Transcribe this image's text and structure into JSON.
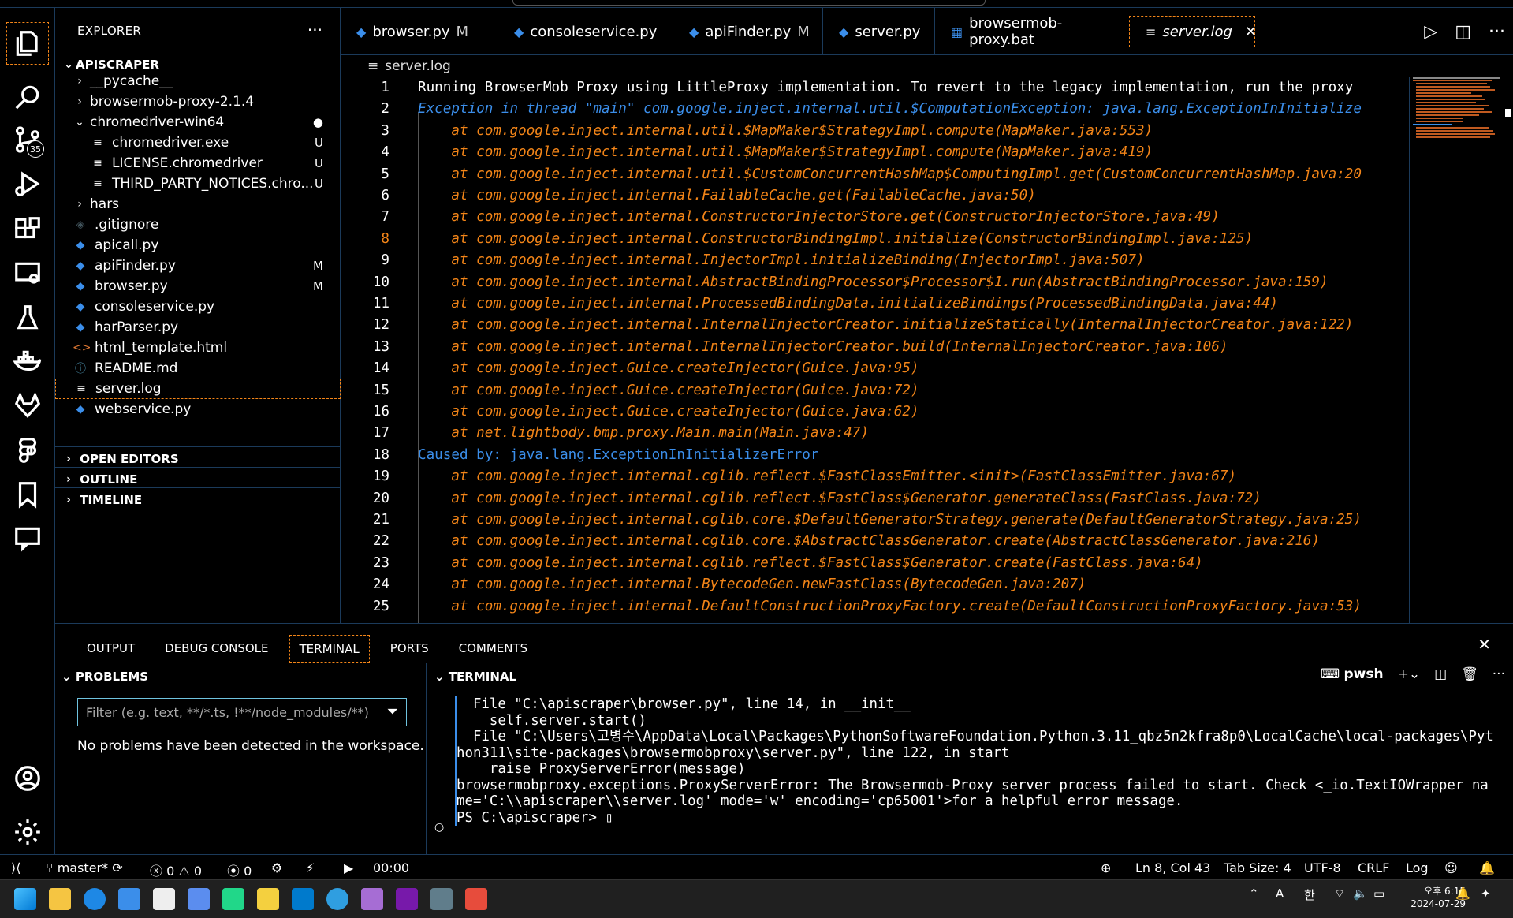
{
  "sidebar": {
    "title": "EXPLORER",
    "more": "···",
    "root": "APISCRAPER",
    "items": [
      {
        "label": "__pycache__",
        "type": "folder",
        "expanded": false,
        "mark": ""
      },
      {
        "label": "browsermob-proxy-2.1.4",
        "type": "folder",
        "expanded": false,
        "mark": ""
      },
      {
        "label": "chromedriver-win64",
        "type": "folder",
        "expanded": true,
        "mark": "●"
      },
      {
        "label": "chromedriver.exe",
        "type": "file",
        "mark": "U"
      },
      {
        "label": "LICENSE.chromedriver",
        "type": "file",
        "mark": "U"
      },
      {
        "label": "THIRD_PARTY_NOTICES.chro...",
        "type": "file",
        "mark": "U"
      },
      {
        "label": "hars",
        "type": "folder",
        "expanded": false,
        "mark": ""
      },
      {
        "label": ".gitignore",
        "type": "git",
        "mark": ""
      },
      {
        "label": "apicall.py",
        "type": "py",
        "mark": ""
      },
      {
        "label": "apiFinder.py",
        "type": "py",
        "mark": "M"
      },
      {
        "label": "browser.py",
        "type": "py",
        "mark": "M"
      },
      {
        "label": "consoleservice.py",
        "type": "py",
        "mark": ""
      },
      {
        "label": "harParser.py",
        "type": "py",
        "mark": ""
      },
      {
        "label": "html_template.html",
        "type": "html",
        "mark": ""
      },
      {
        "label": "README.md",
        "type": "info",
        "mark": ""
      },
      {
        "label": "server.log",
        "type": "log",
        "mark": ""
      },
      {
        "label": "webservice.py",
        "type": "py",
        "mark": ""
      }
    ],
    "sections": [
      "OPEN EDITORS",
      "OUTLINE",
      "TIMELINE"
    ]
  },
  "activity": {
    "scm_badge": "35"
  },
  "tabs": [
    {
      "label": "browser.py",
      "mod": "M"
    },
    {
      "label": "consoleservice.py",
      "mod": ""
    },
    {
      "label": "apiFinder.py",
      "mod": "M"
    },
    {
      "label": "server.py",
      "mod": ""
    },
    {
      "label": "browsermob-proxy.bat",
      "mod": ""
    },
    {
      "label": "server.log",
      "mod": ""
    }
  ],
  "breadcrumb": "server.log",
  "editor": {
    "lines": [
      "Running BrowserMob Proxy using LittleProxy implementation. To revert to the legacy implementation, run the proxy",
      "Exception in thread \"main\" com.google.inject.internal.util.$ComputationException: java.lang.ExceptionInInitialize",
      "    at com.google.inject.internal.util.$MapMaker$StrategyImpl.compute(MapMaker.java:553)",
      "    at com.google.inject.internal.util.$MapMaker$StrategyImpl.compute(MapMaker.java:419)",
      "    at com.google.inject.internal.util.$CustomConcurrentHashMap$ComputingImpl.get(CustomConcurrentHashMap.java:20",
      "    at com.google.inject.internal.FailableCache.get(FailableCache.java:50)",
      "    at com.google.inject.internal.ConstructorInjectorStore.get(ConstructorInjectorStore.java:49)",
      "    at com.google.inject.internal.ConstructorBindingImpl.initialize(ConstructorBindingImpl.java:125)",
      "    at com.google.inject.internal.InjectorImpl.initializeBinding(InjectorImpl.java:507)",
      "    at com.google.inject.internal.AbstractBindingProcessor$Processor$1.run(AbstractBindingProcessor.java:159)",
      "    at com.google.inject.internal.ProcessedBindingData.initializeBindings(ProcessedBindingData.java:44)",
      "    at com.google.inject.internal.InternalInjectorCreator.initializeStatically(InternalInjectorCreator.java:122)",
      "    at com.google.inject.internal.InternalInjectorCreator.build(InternalInjectorCreator.java:106)",
      "    at com.google.inject.Guice.createInjector(Guice.java:95)",
      "    at com.google.inject.Guice.createInjector(Guice.java:72)",
      "    at com.google.inject.Guice.createInjector(Guice.java:62)",
      "    at net.lightbody.bmp.proxy.Main.main(Main.java:47)",
      "Caused by: java.lang.ExceptionInInitializerError",
      "    at com.google.inject.internal.cglib.reflect.$FastClassEmitter.<init>(FastClassEmitter.java:67)",
      "    at com.google.inject.internal.cglib.reflect.$FastClass$Generator.generateClass(FastClass.java:72)",
      "    at com.google.inject.internal.cglib.core.$DefaultGeneratorStrategy.generate(DefaultGeneratorStrategy.java:25)",
      "    at com.google.inject.internal.cglib.core.$AbstractClassGenerator.create(AbstractClassGenerator.java:216)",
      "    at com.google.inject.internal.cglib.reflect.$FastClass$Generator.create(FastClass.java:64)",
      "    at com.google.inject.internal.BytecodeGen.newFastClass(BytecodeGen.java:207)",
      "    at com.google.inject.internal.DefaultConstructionProxyFactory.create(DefaultConstructionProxyFactory.java:53)"
    ],
    "current_line": 8
  },
  "panel": {
    "tabs": [
      "OUTPUT",
      "DEBUG CONSOLE",
      "TERMINAL",
      "PORTS",
      "COMMENTS"
    ],
    "active_tab": "TERMINAL",
    "problems_title": "PROBLEMS",
    "filter_placeholder": "Filter (e.g. text, **/*.ts, !**/node_modules/**)",
    "no_problems": "No problems have been detected in the workspace.",
    "terminal_title": "TERMINAL",
    "shell": "pwsh",
    "terminal_lines": [
      "  File \"C:\\apiscraper\\browser.py\", line 14, in __init__",
      "    self.server.start()",
      "  File \"C:\\Users\\고병수\\AppData\\Local\\Packages\\PythonSoftwareFoundation.Python.3.11_qbz5n2kfra8p0\\LocalCache\\local-packages\\Python311\\site-packages\\browsermobproxy\\server.py\", line 122, in start",
      "    raise ProxyServerError(message)",
      "browsermobproxy.exceptions.ProxyServerError: The Browsermob-Proxy server process failed to start. Check <_io.TextIOWrapper name='C:\\\\apiscraper\\\\server.log' mode='w' encoding='cp65001'>for a helpful error message.",
      "PS C:\\apiscraper> "
    ]
  },
  "status": {
    "branch": "master*",
    "errors": "0",
    "warnings": "0",
    "ports": "0",
    "timer": "00:00",
    "position": "Ln 8, Col 43",
    "tab_size": "Tab Size: 4",
    "encoding": "UTF-8",
    "eol": "CRLF",
    "language": "Log"
  },
  "taskbar": {
    "time": "오후 6:15",
    "date": "2024-07-29",
    "ime": "한",
    "font_mode": "A"
  },
  "colors": {
    "accent": "#f38518",
    "blue": "#3b8eea",
    "border": "#1b3a5a"
  }
}
